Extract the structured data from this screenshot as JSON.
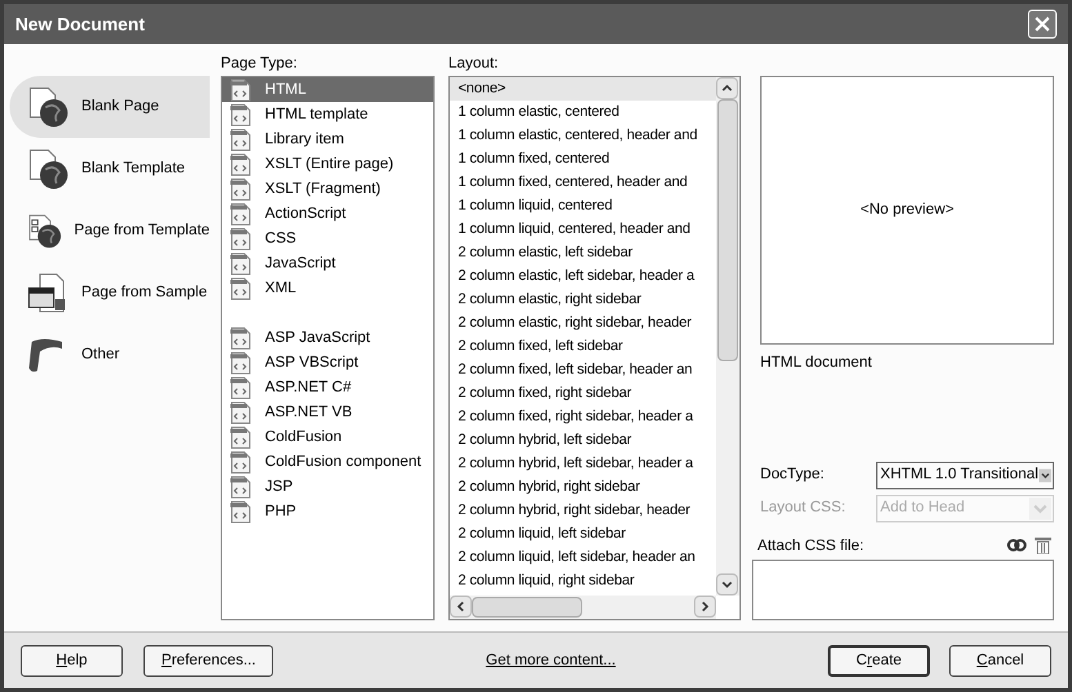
{
  "window": {
    "title": "New Document"
  },
  "categories": [
    {
      "label": "Blank Page",
      "selected": true,
      "kind": "blank"
    },
    {
      "label": "Blank Template",
      "selected": false,
      "kind": "blank"
    },
    {
      "label": "Page from Template",
      "selected": false,
      "kind": "template"
    },
    {
      "label": "Page from Sample",
      "selected": false,
      "kind": "sample"
    },
    {
      "label": "Other",
      "selected": false,
      "kind": "other"
    }
  ],
  "page_type": {
    "heading": "Page Type:",
    "groups": [
      [
        {
          "label": "HTML",
          "selected": true
        },
        {
          "label": "HTML template",
          "selected": false
        },
        {
          "label": "Library item",
          "selected": false
        },
        {
          "label": "XSLT (Entire page)",
          "selected": false
        },
        {
          "label": "XSLT (Fragment)",
          "selected": false
        },
        {
          "label": "ActionScript",
          "selected": false
        },
        {
          "label": "CSS",
          "selected": false
        },
        {
          "label": "JavaScript",
          "selected": false
        },
        {
          "label": "XML",
          "selected": false
        }
      ],
      [
        {
          "label": "ASP JavaScript",
          "selected": false
        },
        {
          "label": "ASP VBScript",
          "selected": false
        },
        {
          "label": "ASP.NET C#",
          "selected": false
        },
        {
          "label": "ASP.NET VB",
          "selected": false
        },
        {
          "label": "ColdFusion",
          "selected": false
        },
        {
          "label": "ColdFusion component",
          "selected": false
        },
        {
          "label": "JSP",
          "selected": false
        },
        {
          "label": "PHP",
          "selected": false
        }
      ]
    ]
  },
  "layout": {
    "heading": "Layout:",
    "items": [
      {
        "label": "<none>",
        "selected": true
      },
      {
        "label": "1 column elastic, centered",
        "selected": false
      },
      {
        "label": "1 column elastic, centered, header and",
        "selected": false
      },
      {
        "label": "1 column fixed, centered",
        "selected": false
      },
      {
        "label": "1 column fixed, centered, header and",
        "selected": false
      },
      {
        "label": "1 column liquid, centered",
        "selected": false
      },
      {
        "label": "1 column liquid, centered, header and",
        "selected": false
      },
      {
        "label": "2 column elastic, left sidebar",
        "selected": false
      },
      {
        "label": "2 column elastic, left sidebar, header a",
        "selected": false
      },
      {
        "label": "2 column elastic, right sidebar",
        "selected": false
      },
      {
        "label": "2 column elastic, right sidebar, header",
        "selected": false
      },
      {
        "label": "2 column fixed, left sidebar",
        "selected": false
      },
      {
        "label": "2 column fixed, left sidebar, header an",
        "selected": false
      },
      {
        "label": "2 column fixed, right sidebar",
        "selected": false
      },
      {
        "label": "2 column fixed, right sidebar, header a",
        "selected": false
      },
      {
        "label": "2 column hybrid, left sidebar",
        "selected": false
      },
      {
        "label": "2 column hybrid, left sidebar, header a",
        "selected": false
      },
      {
        "label": "2 column hybrid, right sidebar",
        "selected": false
      },
      {
        "label": "2 column hybrid, right sidebar, header",
        "selected": false
      },
      {
        "label": "2 column liquid, left sidebar",
        "selected": false
      },
      {
        "label": "2 column liquid, left sidebar, header an",
        "selected": false
      },
      {
        "label": "2 column liquid, right sidebar",
        "selected": false
      }
    ]
  },
  "preview": {
    "text": "<No preview>",
    "description": "HTML document"
  },
  "options": [
    {
      "label": "DocType:",
      "value": "XHTML 1.0 Transitional",
      "disabled": false
    },
    {
      "label": "Layout CSS:",
      "value": "Add to Head",
      "disabled": true
    }
  ],
  "attach_css": {
    "label": "Attach CSS file:"
  },
  "footer": {
    "left_buttons": [
      {
        "key": "H",
        "after": "elp"
      },
      {
        "key": "P",
        "after": "references..."
      }
    ],
    "link": "Get more content...",
    "right_buttons": [
      {
        "before": "C",
        "key": "r",
        "after": "eate",
        "default": true
      },
      {
        "key": "C",
        "after": "ancel",
        "default": false
      }
    ]
  }
}
